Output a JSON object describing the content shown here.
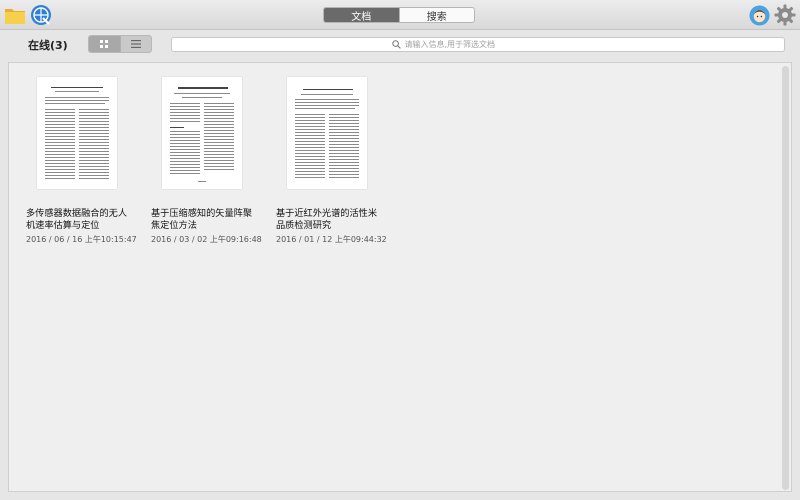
{
  "titlebar": {
    "tabs": [
      {
        "label": "文档",
        "active": true
      },
      {
        "label": "搜索",
        "active": false
      }
    ]
  },
  "toolbar": {
    "status_label": "在线(3)",
    "search_placeholder": "请输入信息,用于筛选文档"
  },
  "documents": [
    {
      "title": "多传感器数据融合的无人机速率估算与定位",
      "date": "2016 / 06 / 16 上午10:15:47"
    },
    {
      "title": "基于压缩感知的矢量阵聚焦定位方法",
      "date": "2016 / 03 / 02 上午09:16:48"
    },
    {
      "title": "基于近红外光谱的活性米品质检测研究",
      "date": "2016 / 01 / 12 上午09:44:32"
    }
  ],
  "colors": {
    "accent_tab": "#6a6a6a",
    "folder": "#f4c542",
    "globe": "#2f7fd8"
  }
}
